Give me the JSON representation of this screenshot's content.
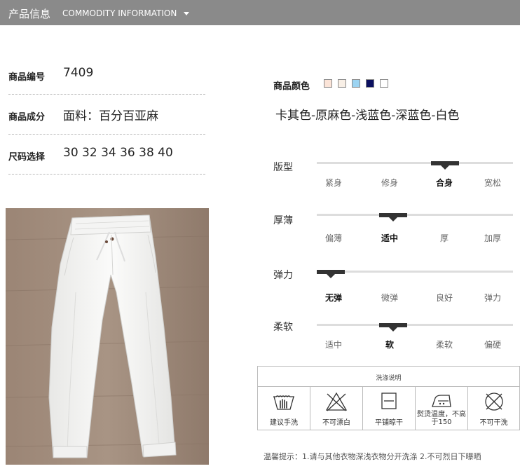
{
  "header": {
    "title_cn": "产品信息",
    "title_en": "COMMODITY INFORMATION"
  },
  "info": [
    {
      "label": "商品编号",
      "value": "7409"
    },
    {
      "label": "商品成分",
      "value": "面料：百分百亚麻"
    },
    {
      "label": "尺码选择",
      "value": "30 32 34 36 38 40"
    }
  ],
  "colors": {
    "label": "商品颜色",
    "swatches": [
      "#fbe4d8",
      "#f8efe6",
      "#9cd4f2",
      "#0b1060",
      "#ffffff"
    ],
    "names": "卡其色-原麻色-浅蓝色-深蓝色-白色"
  },
  "specs": [
    {
      "label": "版型",
      "options": [
        "紧身",
        "修身",
        "合身",
        "宽松"
      ],
      "selected": 2,
      "level": 0.68
    },
    {
      "label": "厚薄",
      "options": [
        "偏薄",
        "适中",
        "厚",
        "加厚"
      ],
      "selected": 1,
      "level": 0.37
    },
    {
      "label": "弹力",
      "options": [
        "无弹",
        "微弹",
        "良好",
        "弹力"
      ],
      "selected": 0,
      "level": 0.0
    },
    {
      "label": "柔软",
      "options": [
        "适中",
        "软",
        "柔软",
        "偏硬"
      ],
      "selected": 1,
      "level": 0.37
    }
  ],
  "care": {
    "title": "洗涤说明",
    "items": [
      {
        "icon": "hand-wash-icon",
        "text": "建议手洗"
      },
      {
        "icon": "no-bleach-icon",
        "text": "不可漂白"
      },
      {
        "icon": "dry-flat-icon",
        "text": "平铺晾干"
      },
      {
        "icon": "iron-icon",
        "text": "熨烫温度，不高于150"
      },
      {
        "icon": "no-dry-clean-icon",
        "text": "不可干洗"
      }
    ]
  },
  "tip": "温馨提示：1.请与其他衣物深浅衣物分开洗涤   2.不可烈日下曝晒"
}
